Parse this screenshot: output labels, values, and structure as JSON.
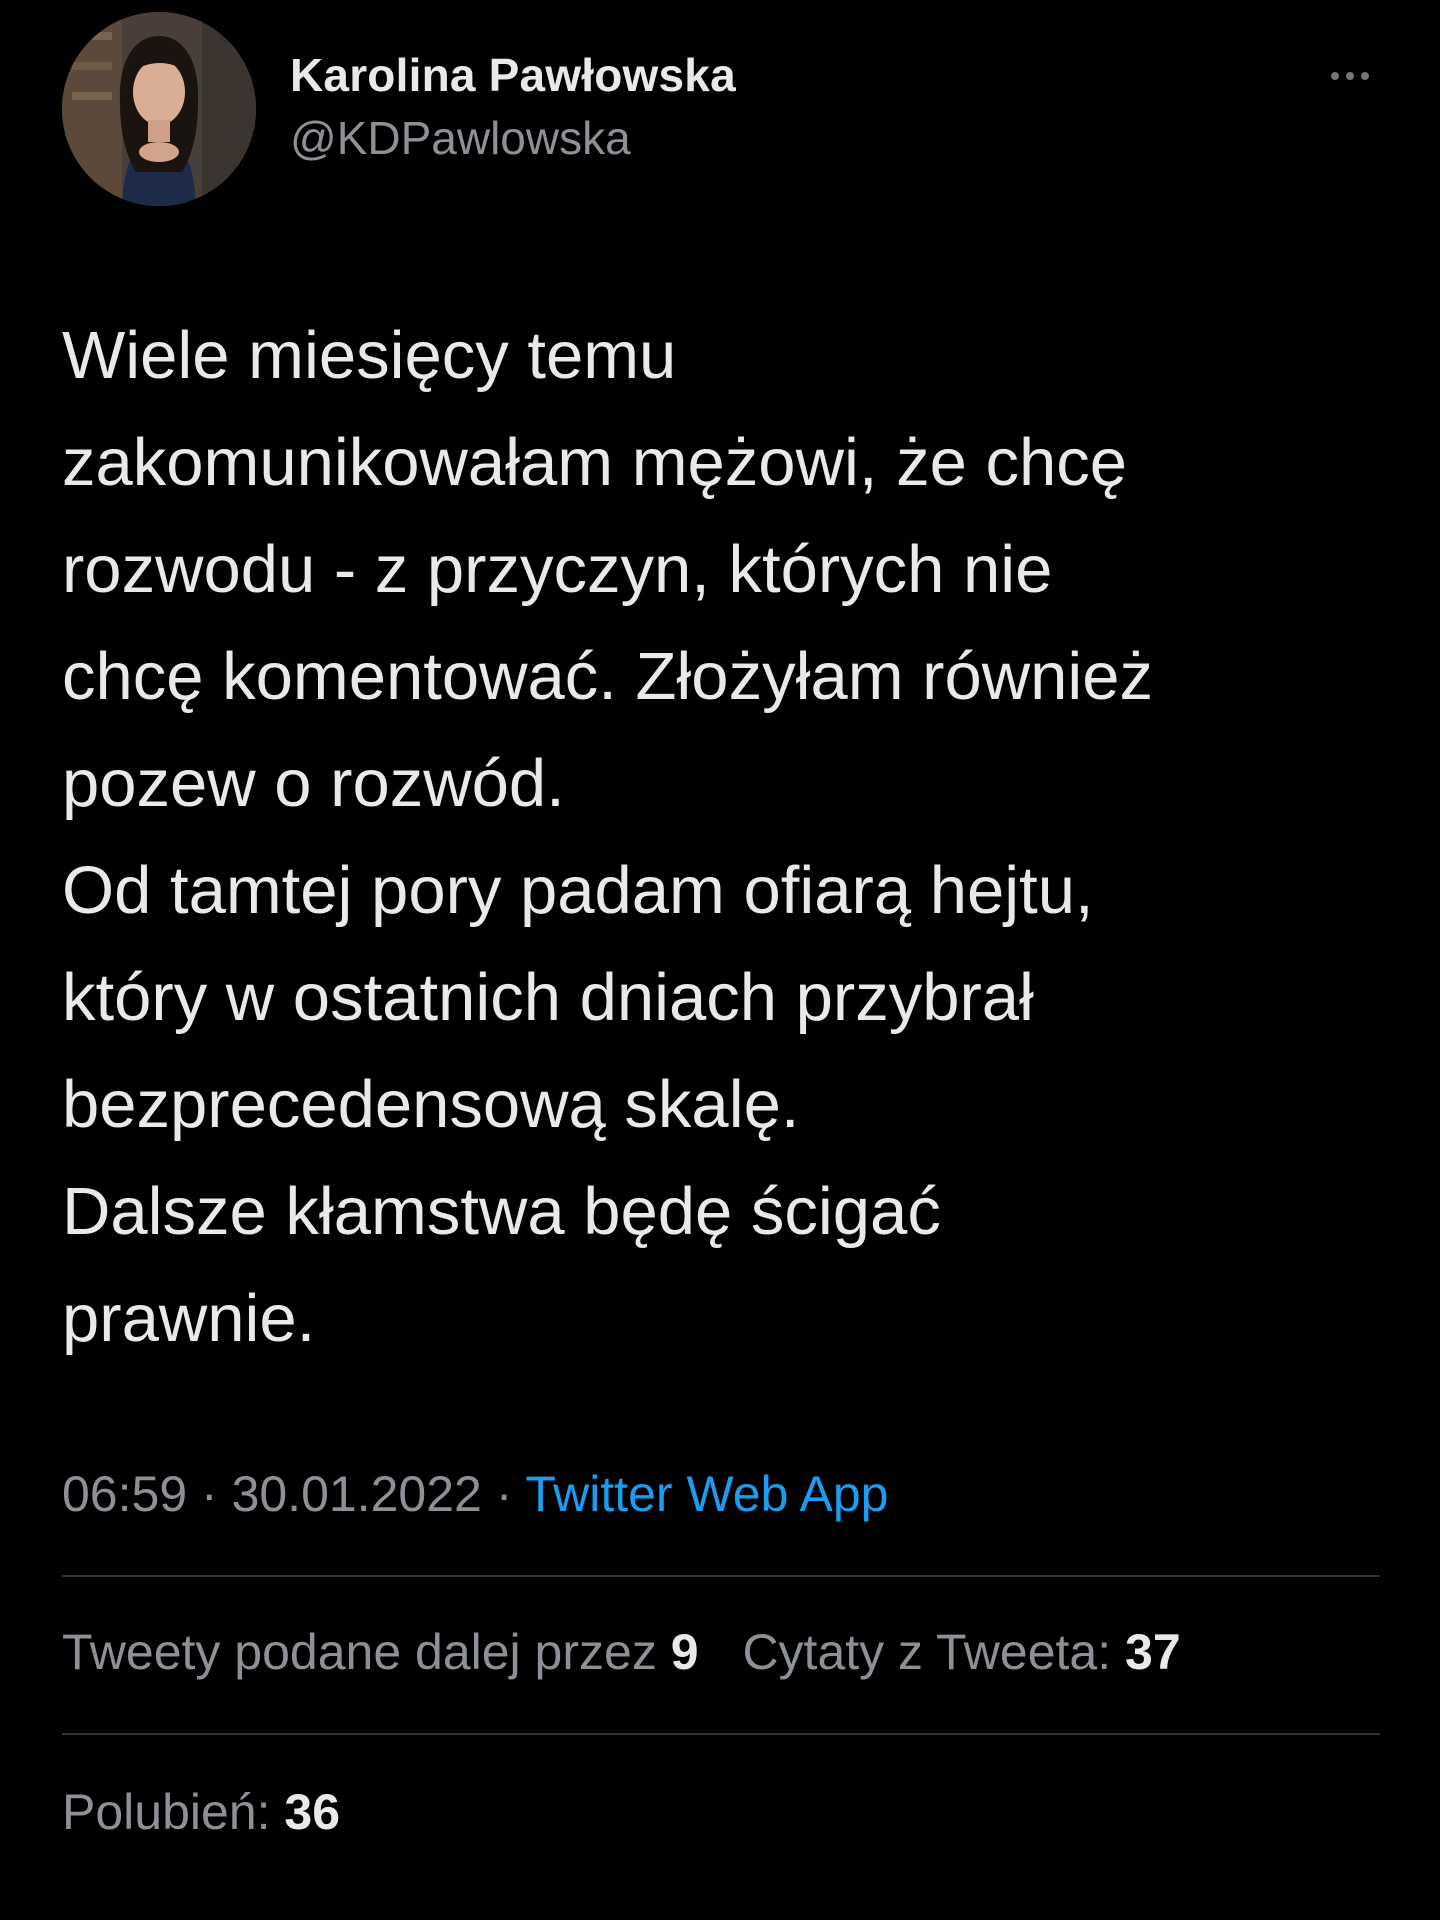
{
  "tweet": {
    "author": {
      "display_name": "Karolina Pawłowska",
      "handle": "@KDPawlowska"
    },
    "more_icon": "more-horizontal-icon",
    "text_lines": [
      "Wiele miesięcy temu",
      "zakomunikowałam mężowi, że chcę",
      "rozwodu - z przyczyn, których nie",
      "chcę komentować. Złożyłam również",
      "pozew o rozwód.",
      "Od tamtej pory padam ofiarą hejtu,",
      "który w ostatnich dniach przybrał",
      "bezprecedensową skalę.",
      "Dalsze kłamstwa będę ścigać",
      "prawnie."
    ],
    "meta": {
      "time": "06:59",
      "separator": " · ",
      "date": "30.01.2022",
      "source": "Twitter Web App"
    },
    "stats": {
      "retweets_label": "Tweety podane dalej przez ",
      "retweets_count": "9",
      "quotes_label": "Cytaty z Tweeta: ",
      "quotes_count": "37",
      "likes_label": "Polubień: ",
      "likes_count": "36"
    }
  },
  "colors": {
    "background": "#000000",
    "primary_text": "#e7e9ea",
    "secondary_text": "#8b9196",
    "link": "#1d9bf0",
    "divider": "#2f3336"
  }
}
